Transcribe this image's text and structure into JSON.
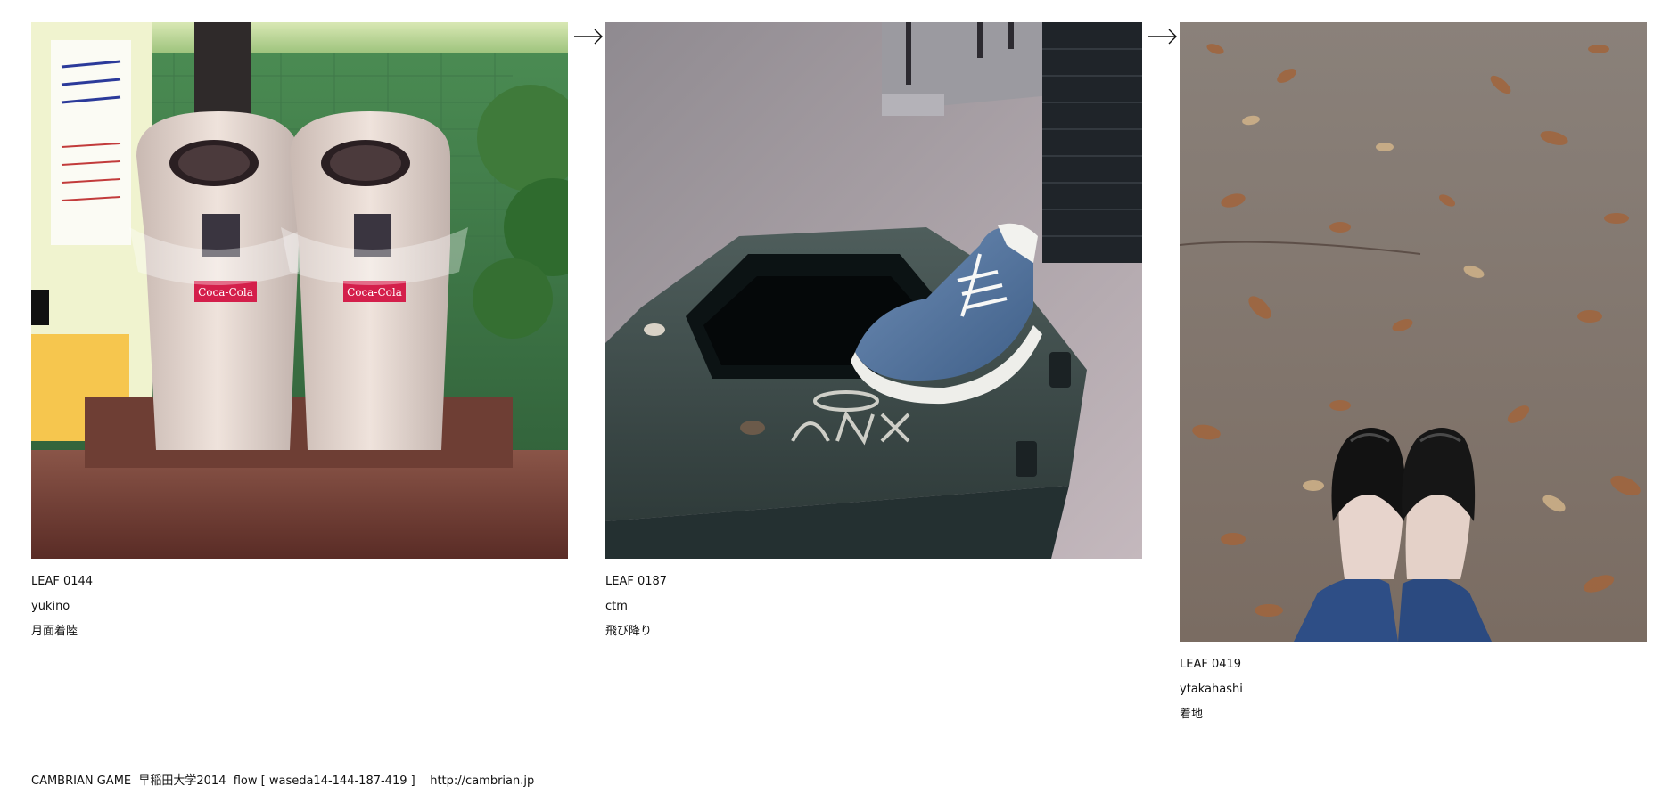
{
  "leaves": [
    {
      "number": "LEAF 0144",
      "author": "yukino",
      "caption": "月面着陸",
      "photo": {
        "subject": "two trash bins beside vending machine",
        "brand_label": "Coca-Cola"
      }
    },
    {
      "number": "LEAF 0187",
      "author": "ctm",
      "caption": "飛び降り",
      "photo": {
        "subject": "sneaker on octagonal trash bin"
      }
    },
    {
      "number": "LEAF 0419",
      "author": "ytakahashi",
      "caption": "着地",
      "photo": {
        "subject": "feet on ground with fallen leaves"
      }
    }
  ],
  "arrows": [
    "arrow-right-icon",
    "arrow-right-icon"
  ],
  "footer": {
    "text": "CAMBRIAN GAME  早稲田大学2014  flow [ waseda14-144-187-419 ]    http://cambrian.jp"
  },
  "colors": {
    "background": "#ffffff",
    "text": "#111111"
  }
}
